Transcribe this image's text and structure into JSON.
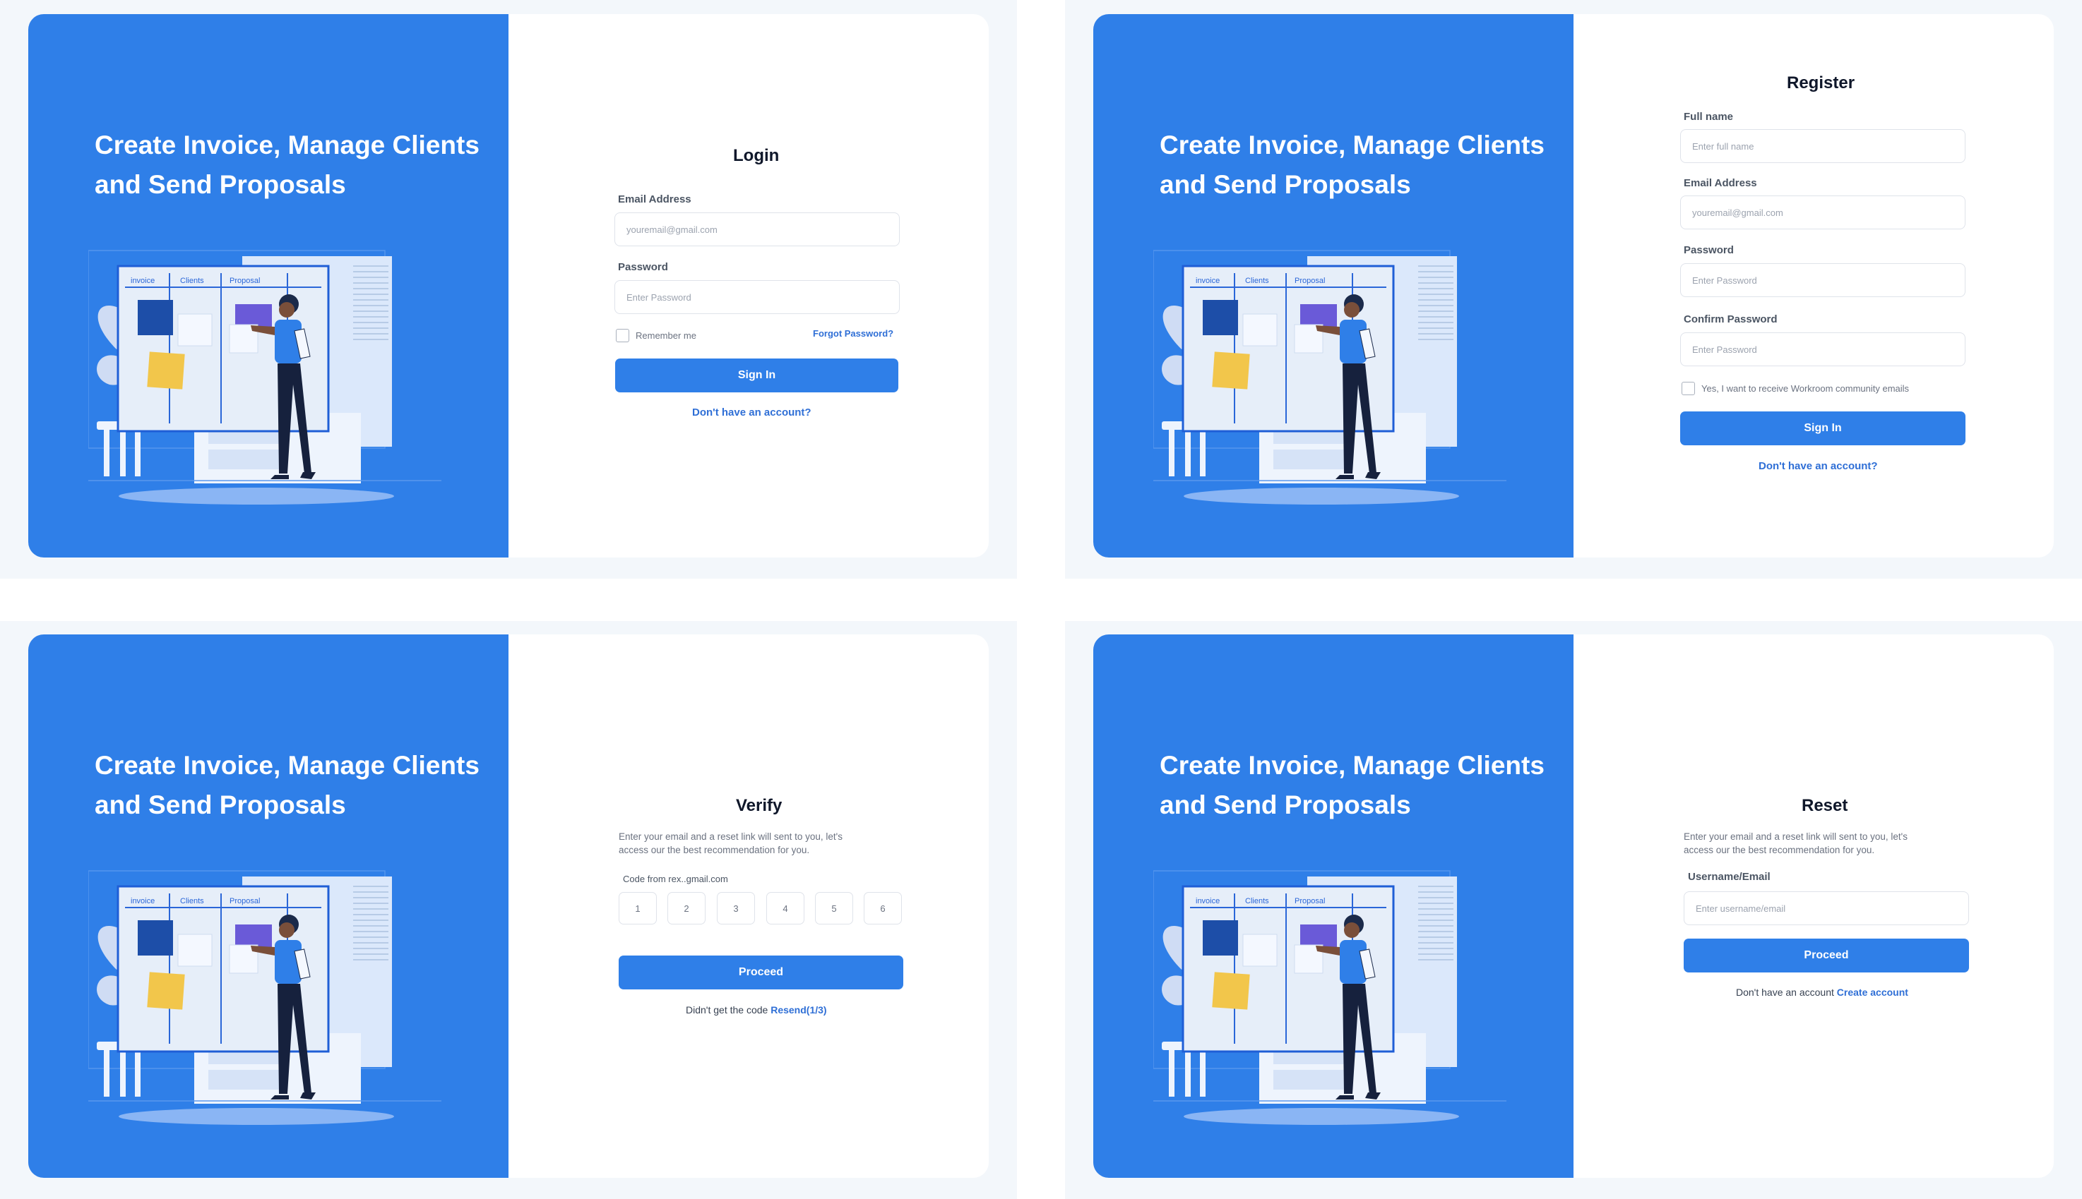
{
  "hero": {
    "headline_line1": "Create Invoice, Manage Clients",
    "headline_line2": "and Send Proposals",
    "board_tabs": [
      "invoice",
      "Clients",
      "Proposal"
    ]
  },
  "colors": {
    "brand_blue": "#2f7fe8",
    "link_blue": "#2f6fd6",
    "panel_bg": "#f3f7fb"
  },
  "login": {
    "title": "Login",
    "email_label": "Email Address",
    "email_placeholder": "youremail@gmail.com",
    "password_label": "Password",
    "password_placeholder": "Enter Password",
    "remember_label": "Remember me",
    "forgot_link": "Forgot Password?",
    "submit_label": "Sign In",
    "account_link": "Don't have an account?"
  },
  "register": {
    "title": "Register",
    "fullname_label": "Full name",
    "fullname_placeholder": "Enter full name",
    "email_label": "Email Address",
    "email_placeholder": "youremail@gmail.com",
    "password_label": "Password",
    "password_placeholder": "Enter Password",
    "confirm_label": "Confirm Password",
    "confirm_placeholder": "Enter Password",
    "optin_label": "Yes, I want to receive Workroom community emails",
    "submit_label": "Sign In",
    "account_link": "Don't have an account?"
  },
  "verify": {
    "title": "Verify",
    "description_line1": "Enter your email and a reset link will sent to you, let's",
    "description_line2": "access our the best recommendation for you.",
    "code_label": "Code from rex..gmail.com",
    "code_digits": [
      "1",
      "2",
      "3",
      "4",
      "5",
      "6"
    ],
    "submit_label": "Proceed",
    "resend_prefix": "Didn't get the code",
    "resend_link": "Resend(1/3)"
  },
  "reset": {
    "title": "Reset",
    "description_line1": "Enter your email and a reset link will sent to you, let's",
    "description_line2": "access our the best recommendation for you.",
    "username_label": "Username/Email",
    "username_placeholder": "Enter username/email",
    "submit_label": "Proceed",
    "create_prefix": "Don't have an account",
    "create_link": "Create account"
  }
}
